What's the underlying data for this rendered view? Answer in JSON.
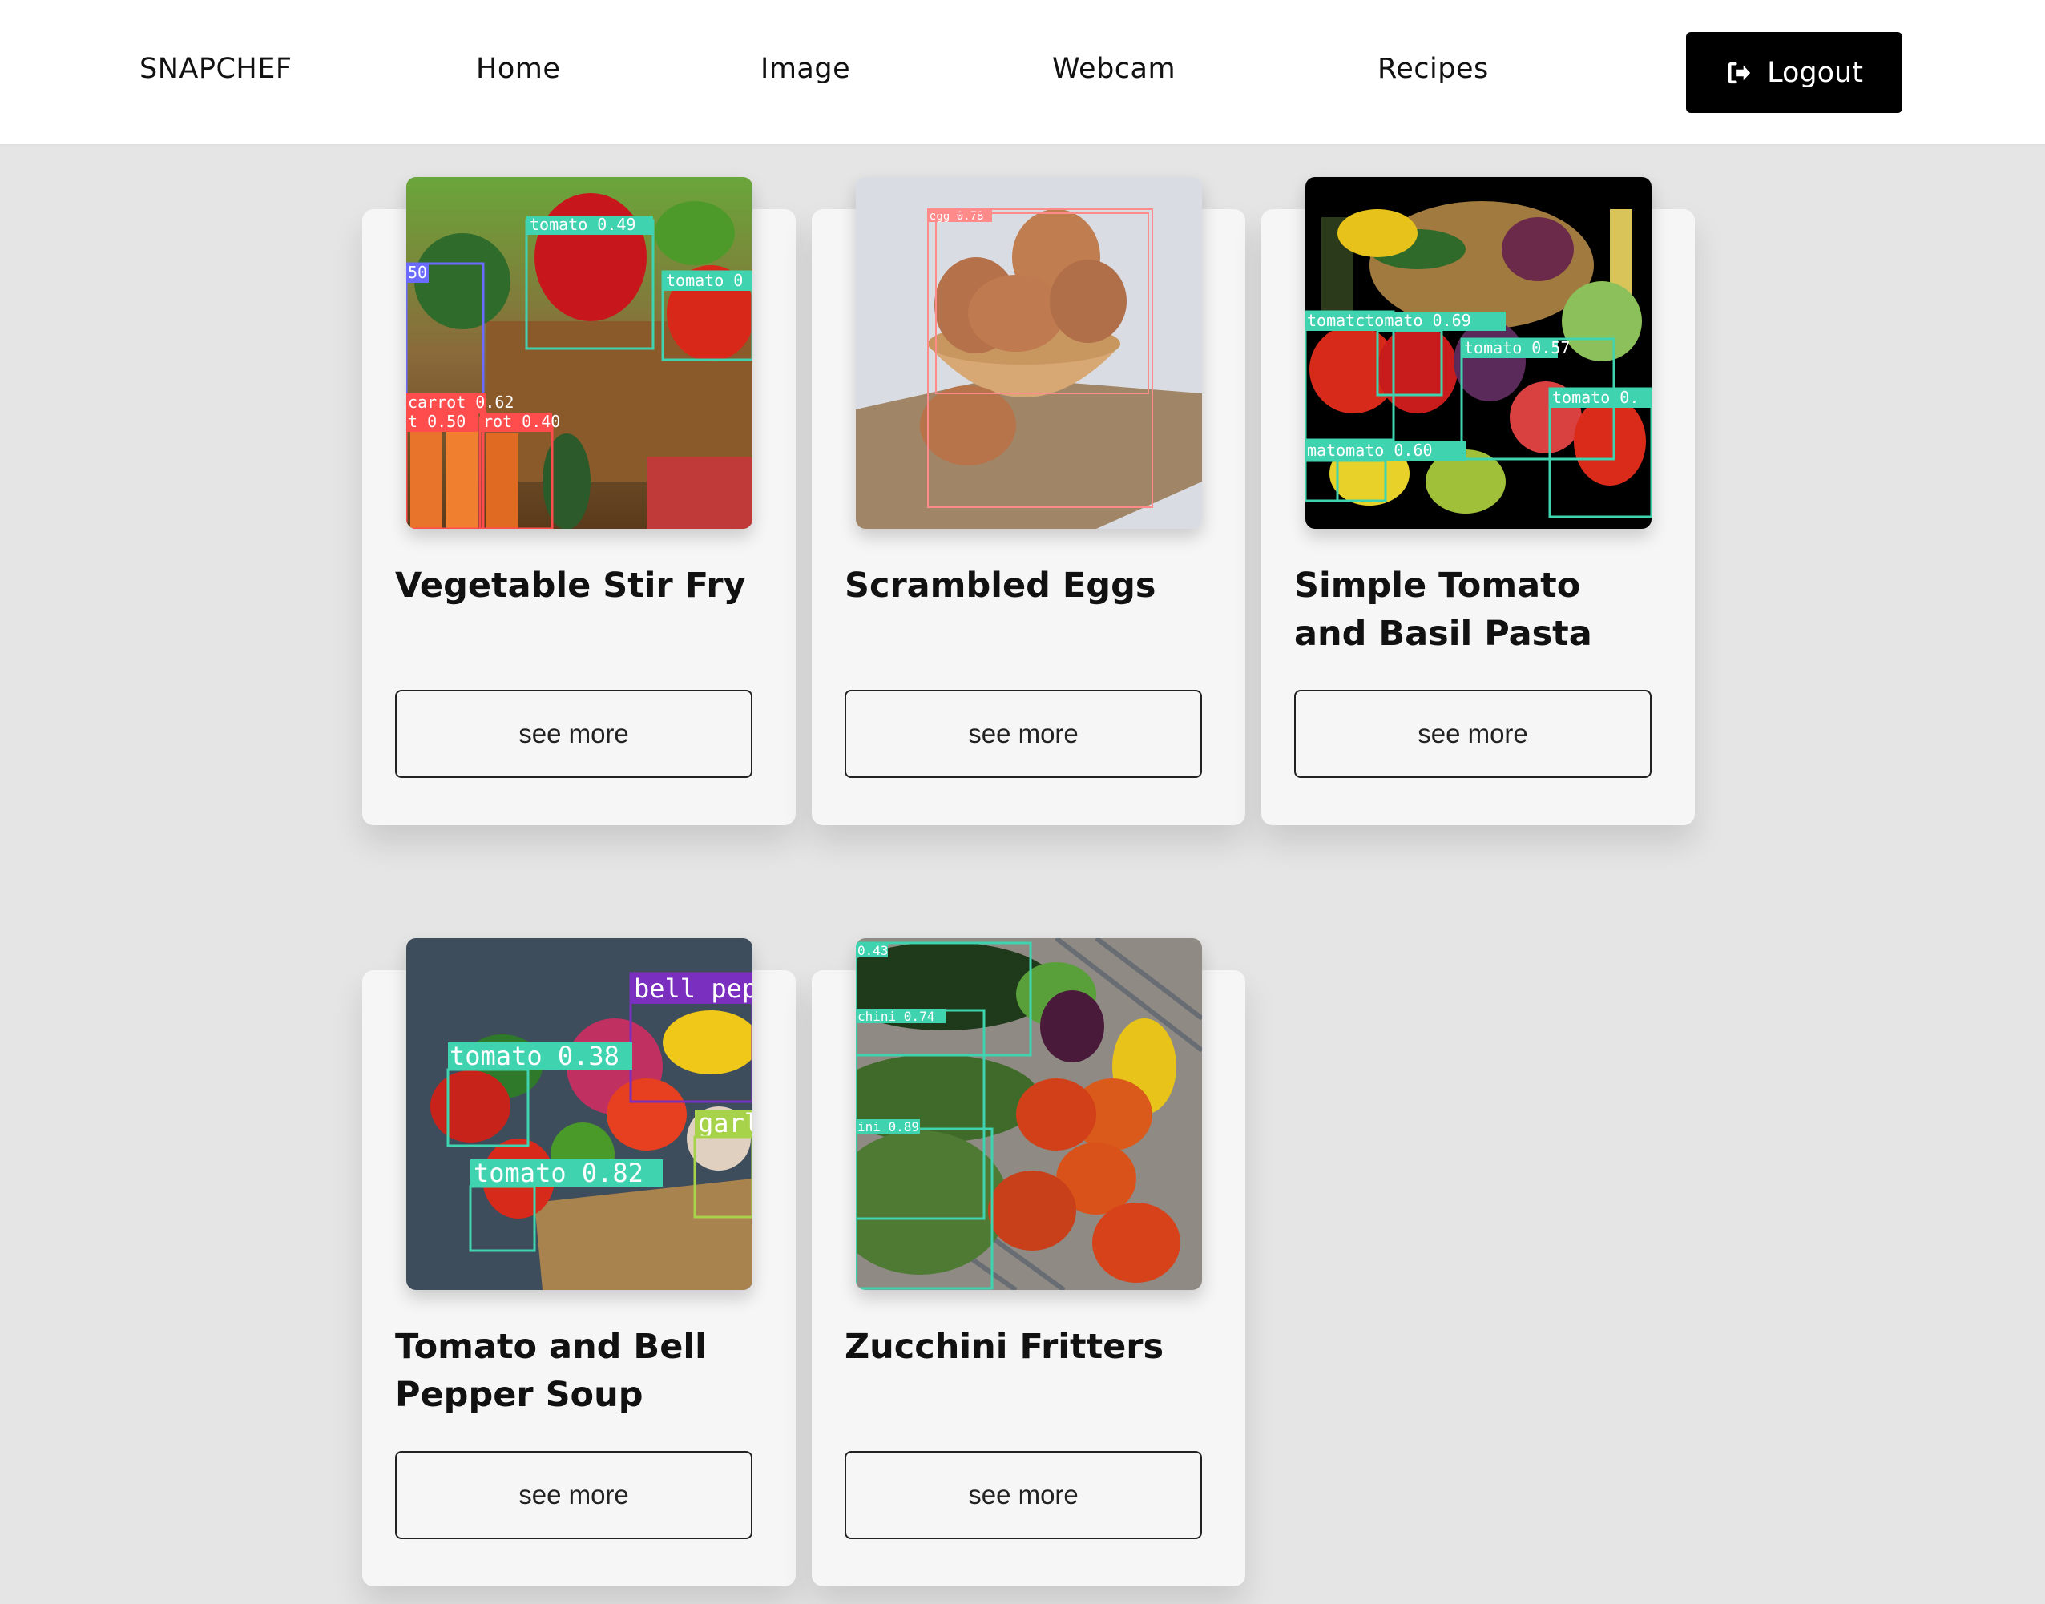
{
  "nav": {
    "brand": "SNAPCHEF",
    "home": "Home",
    "image": "Image",
    "webcam": "Webcam",
    "recipes": "Recipes",
    "logout": "Logout"
  },
  "recipes": [
    {
      "title": "Vegetable Stir Fry",
      "button": "see more",
      "detections": [
        "tomato 0.49",
        "tomato 0",
        "50",
        "carrot 0.62",
        "t 0.50",
        "rot 0.40"
      ]
    },
    {
      "title": "Scrambled Eggs",
      "button": "see more",
      "detections": [
        "egg 0.78"
      ]
    },
    {
      "title": "Simple Tomato and Basil Pasta",
      "button": "see more",
      "detections": [
        "tomatctomato 0.69",
        "tomato 0.57",
        "tomato 0.",
        "matomato 0.60"
      ]
    },
    {
      "title": "Tomato and Bell Pepper Soup",
      "button": "see more",
      "detections": [
        "bell pep",
        "tomato 0.38",
        "garl",
        "tomato 0.82"
      ]
    },
    {
      "title": "Zucchini Fritters",
      "button": "see more",
      "detections": [
        "0.43",
        "chini 0.74",
        "ini 0.89"
      ]
    }
  ],
  "colors": {
    "background": "#e5e5e5",
    "card": "#f6f6f6",
    "logout_bg": "#000000",
    "detect_teal": "#3fd3b0",
    "detect_red": "#ff4d4d",
    "detect_purple": "#7b2fbf"
  }
}
